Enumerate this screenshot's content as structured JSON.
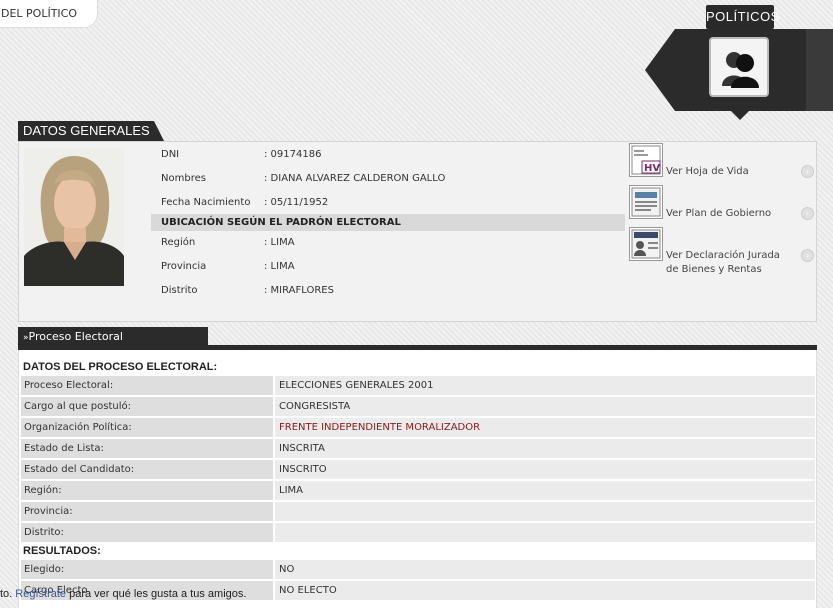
{
  "top_tab": {
    "label": "DEL POLÍTICO"
  },
  "politicos": {
    "label": "POLÍTICOS",
    "icon": "people-silhouette-icon"
  },
  "datos_generales": {
    "title": "DATOS GENERALES",
    "fields": [
      {
        "label": "DNI",
        "value": ": 09174186"
      },
      {
        "label": "Nombres",
        "value": ": DIANA ALVAREZ CALDERON GALLO"
      },
      {
        "label": "Fecha Nacimiento",
        "value": ": 05/11/1952"
      }
    ],
    "ubicacion_title": "UBICACIÓN SEGÚN EL PADRÓN ELECTORAL",
    "ubicacion": [
      {
        "label": "Región",
        "value": ": LIMA"
      },
      {
        "label": "Provincia",
        "value": ": LIMA"
      },
      {
        "label": "Distrito",
        "value": ": MIRAFLORES"
      }
    ],
    "links": [
      {
        "label": "Ver Hoja de Vida",
        "icon": "hv-document-icon"
      },
      {
        "label": "Ver Plan de Gobierno",
        "icon": "plan-document-icon"
      },
      {
        "label": "Ver Declaración Jurada de Bienes y Rentas",
        "icon": "declaration-document-icon"
      }
    ]
  },
  "proceso": {
    "title": "Proceso Electoral",
    "datos_heading": "DATOS DEL PROCESO ELECTORAL:",
    "rows": [
      {
        "label": "Proceso Electoral:",
        "value": "ELECCIONES GENERALES 2001"
      },
      {
        "label": "Cargo al que postuló:",
        "value": "CONGRESISTA"
      },
      {
        "label": "Organización Política:",
        "value": "FRENTE INDEPENDIENTE MORALIZADOR"
      },
      {
        "label": "Estado de Lista:",
        "value": "INSCRITA"
      },
      {
        "label": "Estado del Candidato:",
        "value": "INSCRITO"
      },
      {
        "label": "Región:",
        "value": "LIMA"
      },
      {
        "label": "Provincia:",
        "value": ""
      },
      {
        "label": "Distrito:",
        "value": ""
      }
    ],
    "resultados_heading": "RESULTADOS:",
    "resultados": [
      {
        "label": "Elegido:",
        "value": "NO"
      },
      {
        "label": "Cargo Electo",
        "value": "NO ELECTO"
      }
    ]
  },
  "footer": {
    "prefix": "to. ",
    "link": "Regístrate",
    "suffix": " para ver qué les gusta a tus amigos."
  },
  "colors": {
    "dark": "#2b2b2b",
    "party_red": "#8b1a1a",
    "label_bg": "#dedede",
    "value_bg": "#ebebeb"
  }
}
